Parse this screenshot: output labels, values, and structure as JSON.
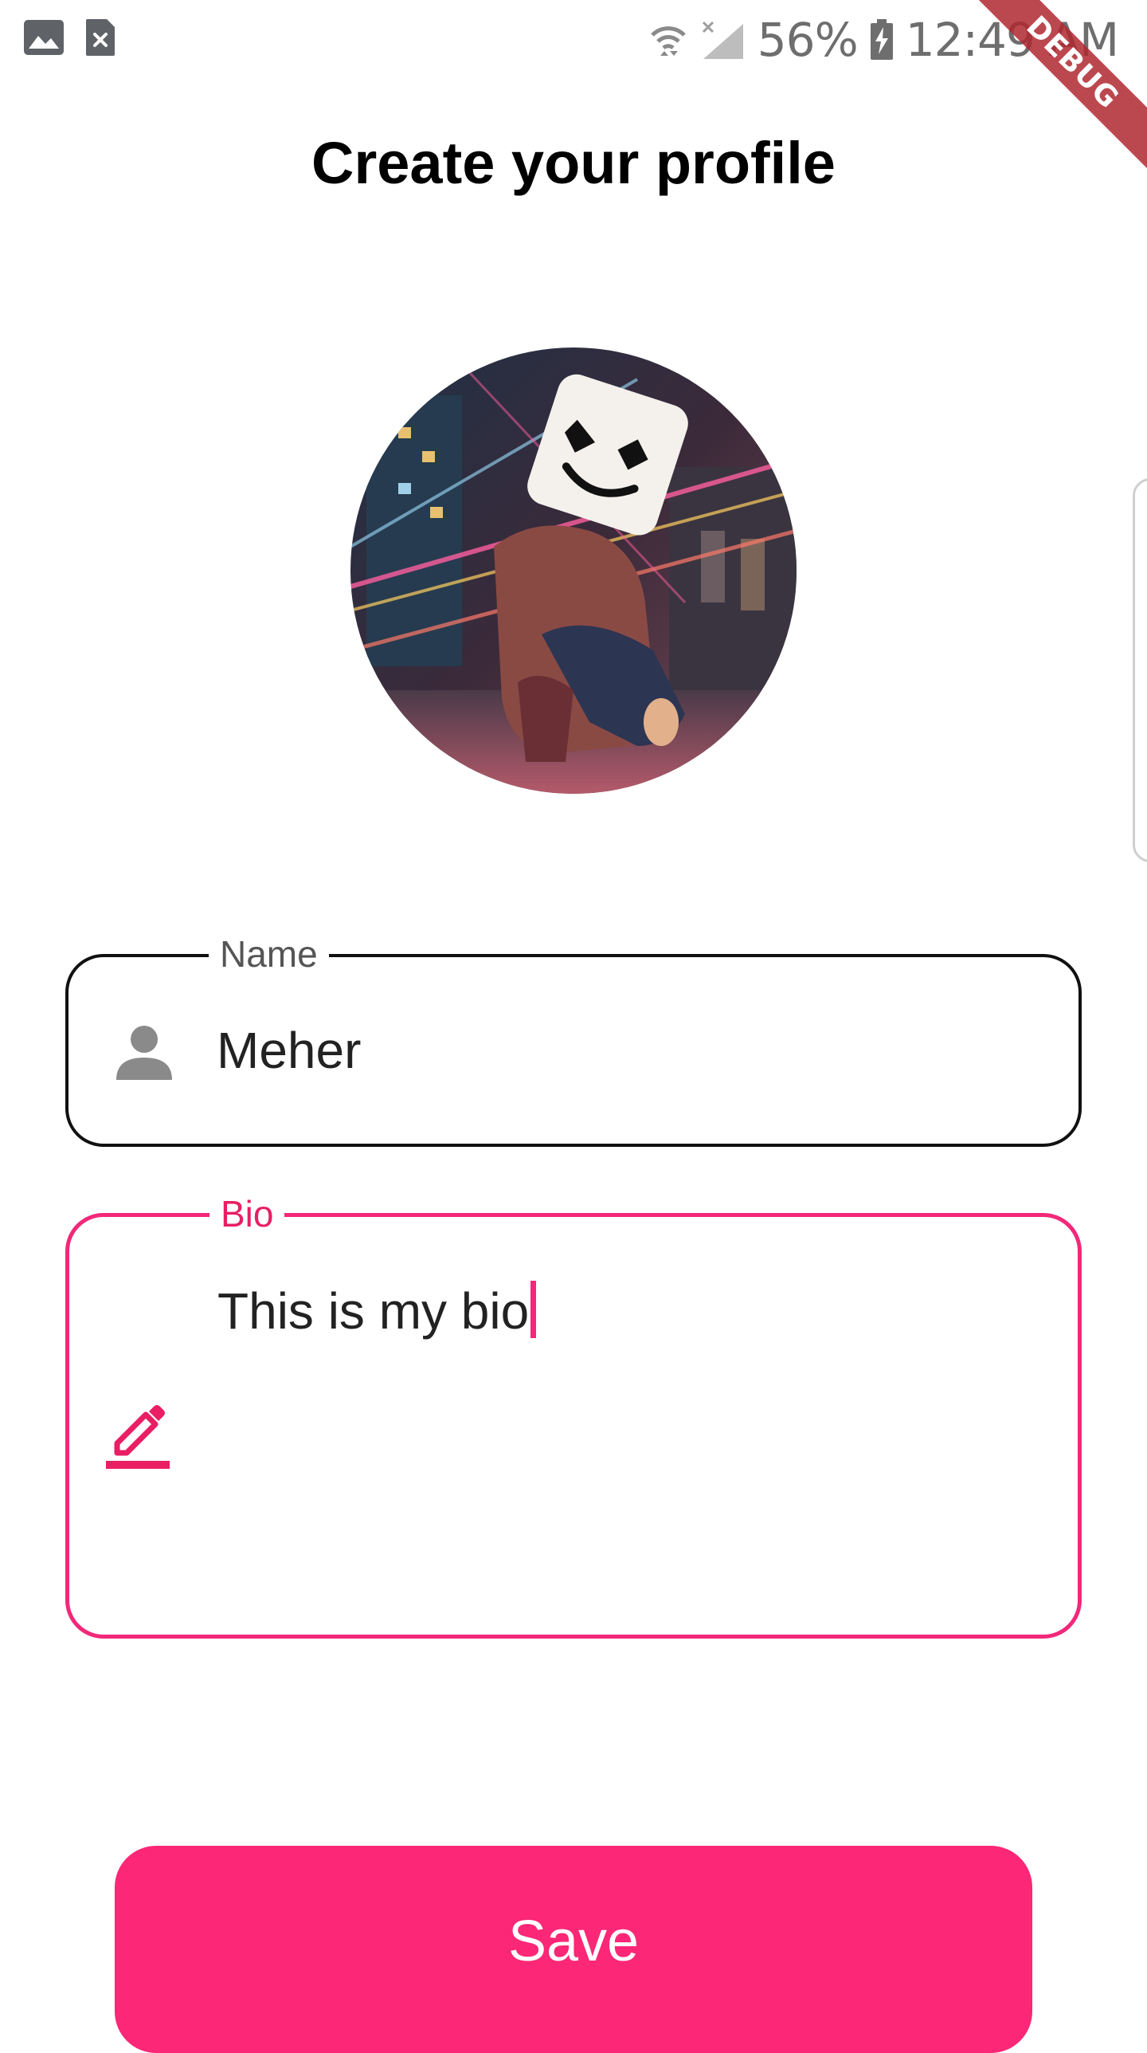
{
  "status_bar": {
    "notification_icons": [
      "gallery-icon",
      "file-dismiss-icon"
    ],
    "battery": "56%",
    "time": "12:49 AM",
    "icons": [
      "wifi-icon",
      "no-signal-icon",
      "battery-charging-icon"
    ]
  },
  "debug_banner": "DEBUG",
  "header": {
    "title": "Create your profile"
  },
  "avatar": {
    "icon": "profile-photo"
  },
  "form": {
    "name": {
      "label": "Name",
      "value": "Meher",
      "icon": "person-icon"
    },
    "bio": {
      "label": "Bio",
      "value": "This is my bio",
      "icon": "edit-icon"
    }
  },
  "actions": {
    "save_label": "Save"
  },
  "colors": {
    "accent": "#fc2776",
    "focused_border": "#f2287a",
    "label_focused": "#e91e63",
    "border": "#111111",
    "debug_ribbon": "#b02830"
  }
}
